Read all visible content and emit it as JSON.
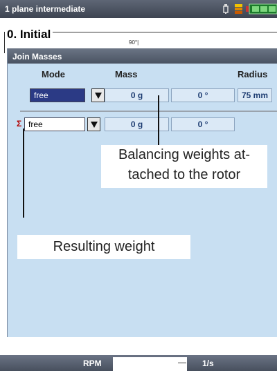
{
  "window": {
    "title": "1 plane intermediate"
  },
  "status_icons": [
    "sensor-icon",
    "transducer-icon",
    "battery-icon"
  ],
  "section": {
    "title": "0. Initial",
    "angle_label": "90°|"
  },
  "panel": {
    "title": "Join Masses"
  },
  "columns": {
    "mode": "Mode",
    "mass": "Mass",
    "radius": "Radius"
  },
  "rows": [
    {
      "mode": "free",
      "mass": "0 g",
      "angle": "0 °",
      "radius": "75 mm"
    }
  ],
  "result": {
    "mode": "free",
    "mass": "0 g",
    "angle": "0 °"
  },
  "annotations": {
    "weights_line1": "Balancing weights at-",
    "weights_line2": "tached to the rotor",
    "result": "Resulting weight"
  },
  "footer": {
    "rpm_label": "RPM",
    "rpm_value": "—",
    "rpm_unit": "1/s"
  },
  "colors": {
    "panel": "#c8dff2",
    "titlebar": "#4a5362",
    "active_select": "#2b3a85",
    "cell_text": "#1e3d72",
    "sigma": "#b20000"
  }
}
